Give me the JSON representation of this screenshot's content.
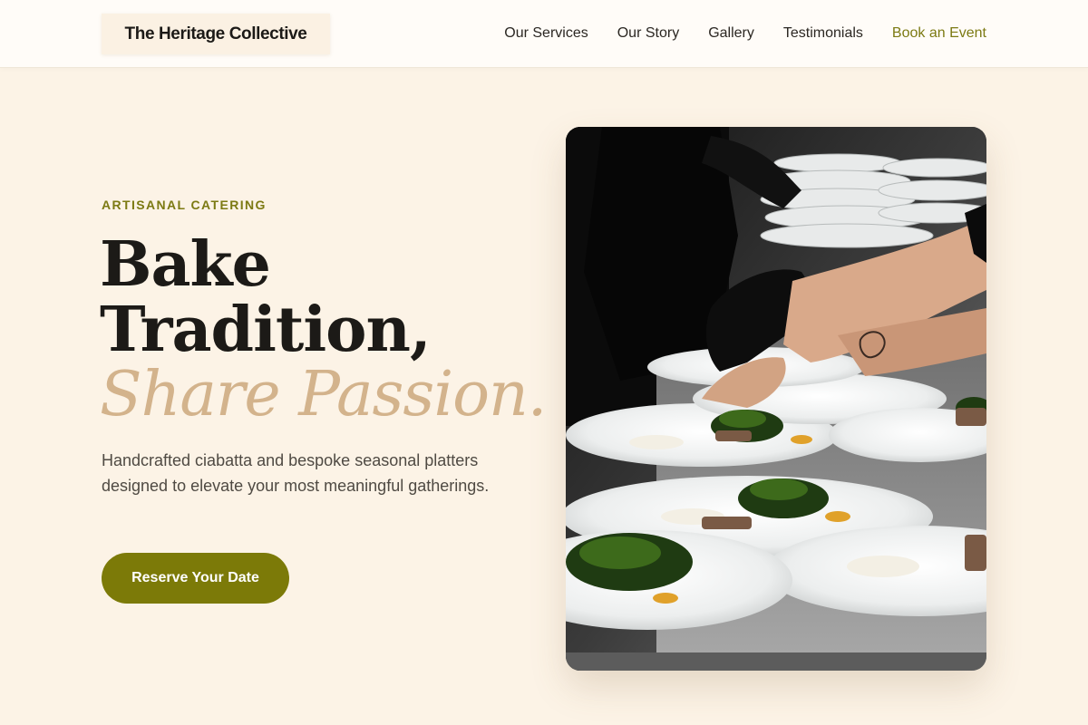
{
  "brand": {
    "name": "The Heritage Collective"
  },
  "nav": {
    "items": [
      "Our Services",
      "Our Story",
      "Gallery",
      "Testimonials"
    ],
    "cta": "Book an Event"
  },
  "hero": {
    "eyebrow": "ARTISANAL CATERING",
    "headline_line1": "Bake",
    "headline_line2": "Tradition,",
    "headline_line3": "Share Passion.",
    "subtext": "Handcrafted ciabatta and bespoke seasonal platters designed to elevate your most meaningful gatherings.",
    "cta_label": "Reserve Your Date",
    "image_alt": "Chefs plating dishes in a kitchen"
  },
  "colors": {
    "background": "#fcf3e6",
    "accent_olive": "#7c7a08",
    "accent_tan": "#d3b38c",
    "text_dark": "#1c1a17"
  }
}
